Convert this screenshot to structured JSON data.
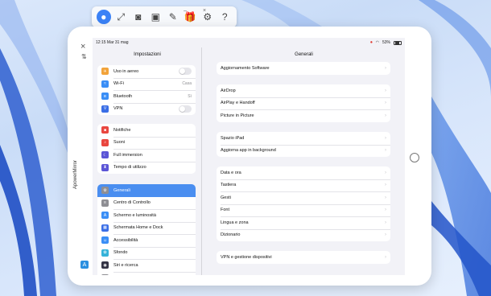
{
  "toolbar": {
    "mini_left": "–",
    "mini_right": "×",
    "buttons": [
      {
        "name": "user-icon",
        "glyph": "●"
      },
      {
        "name": "fullscreen-icon",
        "glyph": "⤢"
      },
      {
        "name": "screenshot-icon",
        "glyph": "◙"
      },
      {
        "name": "record-icon",
        "glyph": "▣"
      },
      {
        "name": "pen-icon",
        "glyph": "✎"
      },
      {
        "name": "gift-icon",
        "glyph": "🎁"
      },
      {
        "name": "gear-icon",
        "glyph": "⚙"
      },
      {
        "name": "help-icon",
        "glyph": "?"
      }
    ]
  },
  "frame": {
    "close": "×",
    "arrow": "⇅",
    "brand": "ApowerMirror",
    "brand_logo": "A"
  },
  "status_bar": {
    "time_date": "12:15  Mar 31 mag",
    "recording": "⏺",
    "wifi": "◠",
    "battery_pct": "53%"
  },
  "sidebar": {
    "title": "Impostazioni",
    "groups": [
      [
        {
          "label": "Uso in aereo",
          "color": "#f2a33a",
          "glyph": "✈",
          "toggle": true
        },
        {
          "label": "Wi-Fi",
          "color": "#3a8ef6",
          "glyph": "≈",
          "value": "Casa"
        },
        {
          "label": "Bluetooth",
          "color": "#3a8ef6",
          "glyph": "ʙ",
          "value": "Sì"
        },
        {
          "label": "VPN",
          "color": "#3a6ee6",
          "glyph": "V",
          "toggle": true
        }
      ],
      [
        {
          "label": "Notifiche",
          "color": "#e9463f",
          "glyph": "■"
        },
        {
          "label": "Suoni",
          "color": "#e9463f",
          "glyph": "♪"
        },
        {
          "label": "Full immersion",
          "color": "#5b55d6",
          "glyph": "☾"
        },
        {
          "label": "Tempo di utilizzo",
          "color": "#5b55d6",
          "glyph": "⧗"
        }
      ],
      [
        {
          "label": "Generali",
          "color": "#8e8e93",
          "glyph": "⚙",
          "selected": true
        },
        {
          "label": "Centro di Controllo",
          "color": "#8e8e93",
          "glyph": "≡"
        },
        {
          "label": "Schermo e luminosità",
          "color": "#3a8ef6",
          "glyph": "A"
        },
        {
          "label": "Schermata Home e Dock",
          "color": "#3a6ee6",
          "glyph": "▦"
        },
        {
          "label": "Accessibilità",
          "color": "#3a8ef6",
          "glyph": "☺"
        },
        {
          "label": "Sfondo",
          "color": "#36b3d9",
          "glyph": "✿"
        },
        {
          "label": "Siri e ricerca",
          "color": "#333344",
          "glyph": "◉"
        },
        {
          "label": "",
          "color": "#8e8e93",
          "glyph": ""
        }
      ]
    ]
  },
  "detail": {
    "title": "Generali",
    "groups": [
      [
        "Aggiornamento Software"
      ],
      [
        "AirDrop",
        "AirPlay e Handoff",
        "Picture in Picture"
      ],
      [
        "Spazio iPad",
        "Aggiorna app in background"
      ],
      [
        "Data e ora",
        "Tastiera",
        "Gesti",
        "Font",
        "Lingua e zona",
        "Dizionario"
      ],
      [
        "VPN e gestione dispositivi"
      ]
    ],
    "chevron": "›"
  }
}
